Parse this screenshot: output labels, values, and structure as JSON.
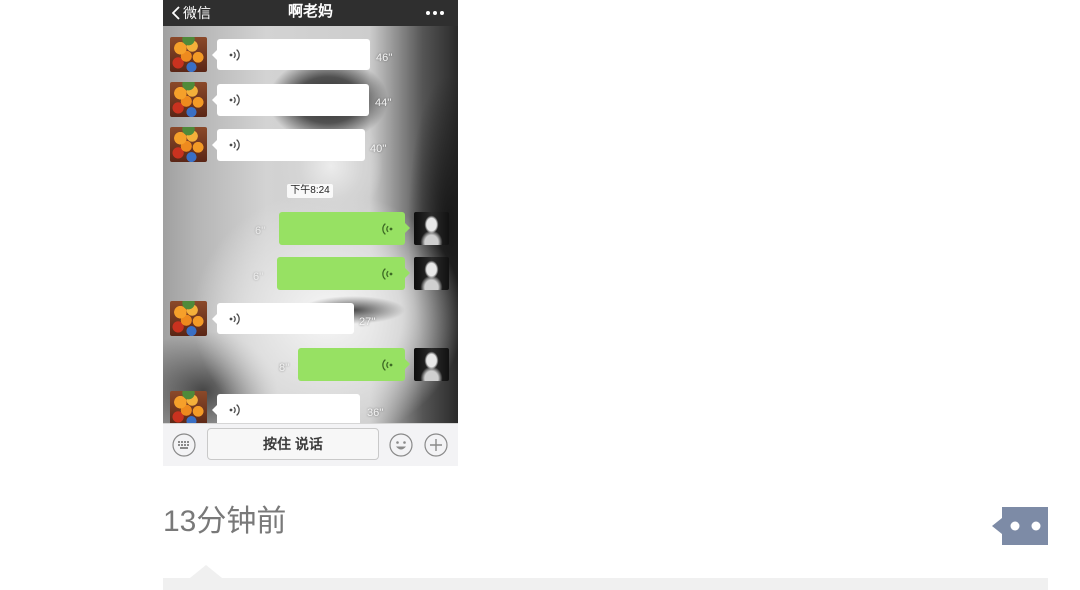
{
  "post": {
    "timestamp": "13分钟前",
    "comment_button_icon": "comment-dots-icon"
  },
  "screenshot": {
    "nav": {
      "back_icon": "chevron-left-icon",
      "back_label": "微信",
      "title": "啊老妈",
      "more_icon": "more-dots-icon"
    },
    "messages": [
      {
        "duration": "46''"
      },
      {
        "duration": "44''"
      },
      {
        "duration": "40''"
      },
      {
        "duration": "6''"
      },
      {
        "duration": "6''"
      },
      {
        "duration": "27''"
      },
      {
        "duration": "8''"
      },
      {
        "duration": "36''"
      }
    ],
    "time_divider": "下午8:24",
    "input_bar": {
      "keyboard_icon": "keyboard-icon",
      "hold_to_talk_label": "按住 说话",
      "emoji_icon": "smiley-icon",
      "more_icon": "plus-icon"
    }
  },
  "colors": {
    "sent_bubble": "#97e163",
    "received_bubble": "#ffffff",
    "comment_button": "#7d8ba6",
    "comment_area": "#f0f0f0",
    "timestamp_text": "#797979",
    "nav_bar": "#2f2f2f"
  }
}
